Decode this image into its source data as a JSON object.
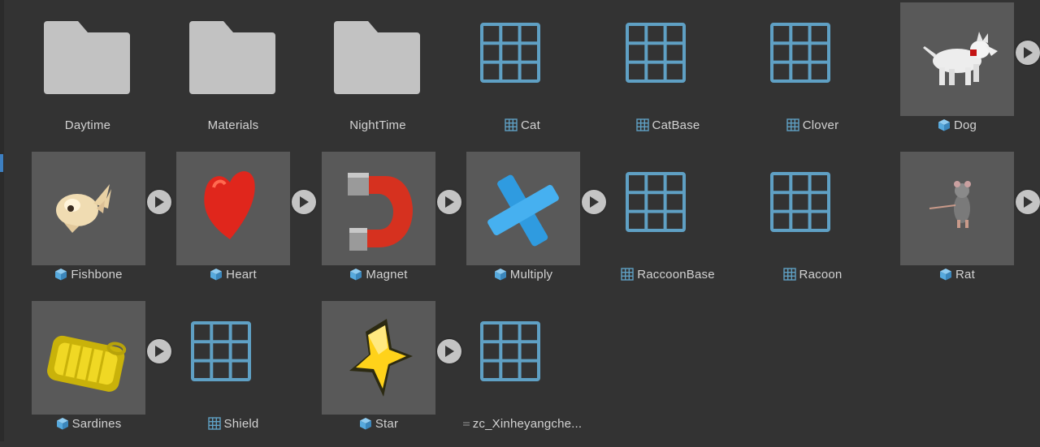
{
  "assets": [
    {
      "name": "Daytime",
      "type": "folder"
    },
    {
      "name": "Materials",
      "type": "folder"
    },
    {
      "name": "NightTime",
      "type": "folder"
    },
    {
      "name": "Cat",
      "type": "grid"
    },
    {
      "name": "CatBase",
      "type": "grid"
    },
    {
      "name": "Clover",
      "type": "grid"
    },
    {
      "name": "Dog",
      "type": "prefab",
      "icon": "dog-model-icon"
    },
    {
      "name": "Fishbone",
      "type": "prefab",
      "icon": "fishbone-model-icon"
    },
    {
      "name": "Heart",
      "type": "prefab",
      "icon": "heart-model-icon"
    },
    {
      "name": "Magnet",
      "type": "prefab",
      "icon": "magnet-model-icon"
    },
    {
      "name": "Multiply",
      "type": "prefab",
      "icon": "multiply-model-icon"
    },
    {
      "name": "RaccoonBase",
      "type": "grid"
    },
    {
      "name": "Racoon",
      "type": "grid"
    },
    {
      "name": "Rat",
      "type": "prefab",
      "icon": "rat-model-icon"
    },
    {
      "name": "Sardines",
      "type": "prefab",
      "icon": "sardines-model-icon"
    },
    {
      "name": "Shield",
      "type": "grid"
    },
    {
      "name": "Star",
      "type": "prefab",
      "icon": "star-model-icon"
    },
    {
      "name": "zc_Xinheyangche...",
      "type": "grid",
      "label_icon": "asset-small-icon"
    }
  ],
  "colors": {
    "background": "#333333",
    "label_text": "#d2d2d2",
    "folder": "#c2c2c2",
    "grid_icon": "#5fa0c4",
    "prefab_thumb_bg": "#595959",
    "prefab_icon": "#56a9dd"
  }
}
